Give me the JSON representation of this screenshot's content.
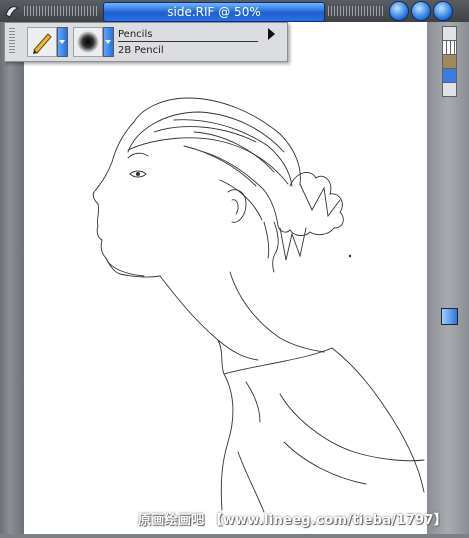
{
  "window": {
    "title": "side.RIF @ 50%"
  },
  "property_bar": {
    "brush_category": "Pencils",
    "brush_variant": "2B Pencil",
    "tool_icon": "pencil-icon",
    "dab_icon": "brush-dab-icon"
  },
  "window_controls": [
    "minimize-button",
    "maximize-button",
    "close-button"
  ],
  "right_panel_icons": [
    "panel-icon-1",
    "grid-icon",
    "image-icon",
    "star-icon",
    "up-arrow-icon"
  ],
  "watermark": "原画绘画吧 【www.lineeg.com/tieba/1797】",
  "colors": {
    "title_blue": "#2a72e6",
    "frame_gray": "#7d8085",
    "canvas": "#ffffff"
  }
}
